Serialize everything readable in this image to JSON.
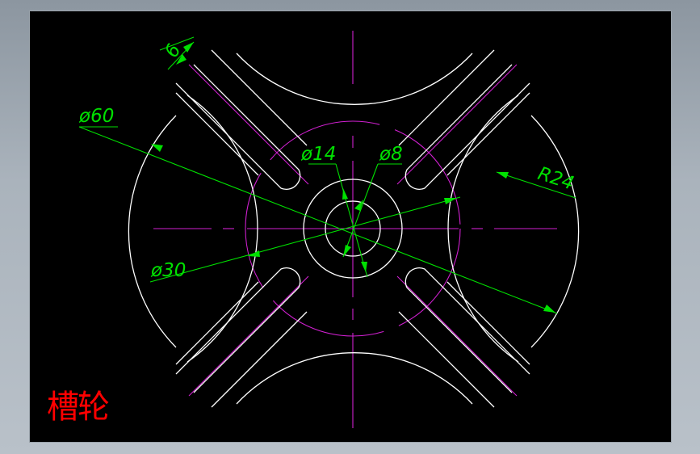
{
  "title": "槽轮",
  "dimensions": {
    "slot_width": "6",
    "outer_diameter": "ø60",
    "hub_diameter": "ø14",
    "bore_diameter": "ø8",
    "arc_radius": "R24",
    "bolt_circle_diameter": "ø30"
  },
  "colors": {
    "background": "#000000",
    "geometry": "#ffffff",
    "centerlines": "#d020d0",
    "dimensions": "#00e000",
    "title": "#ff0000"
  }
}
